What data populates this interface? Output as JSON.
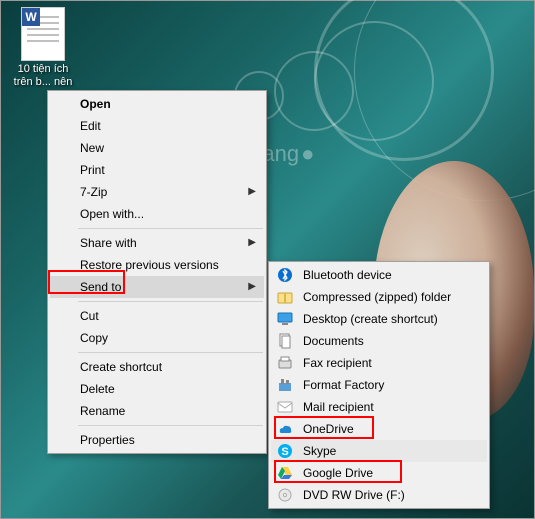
{
  "desktop": {
    "icon_label": "10 tiện ích trên b... nên",
    "doc_letter": "W"
  },
  "watermark": "uantrimang",
  "menu": {
    "open": "Open",
    "edit": "Edit",
    "new": "New",
    "print": "Print",
    "sevenzip": "7-Zip",
    "openwith": "Open with...",
    "sharewith": "Share with",
    "restore": "Restore previous versions",
    "sendto": "Send to",
    "cut": "Cut",
    "copy": "Copy",
    "createshortcut": "Create shortcut",
    "delete": "Delete",
    "rename": "Rename",
    "properties": "Properties"
  },
  "submenu": {
    "bluetooth": "Bluetooth device",
    "zip": "Compressed (zipped) folder",
    "desktop": "Desktop (create shortcut)",
    "documents": "Documents",
    "fax": "Fax recipient",
    "formatfactory": "Format Factory",
    "mail": "Mail recipient",
    "onedrive": "OneDrive",
    "skype": "Skype",
    "googledrive": "Google Drive",
    "dvd": "DVD RW Drive (F:)"
  }
}
